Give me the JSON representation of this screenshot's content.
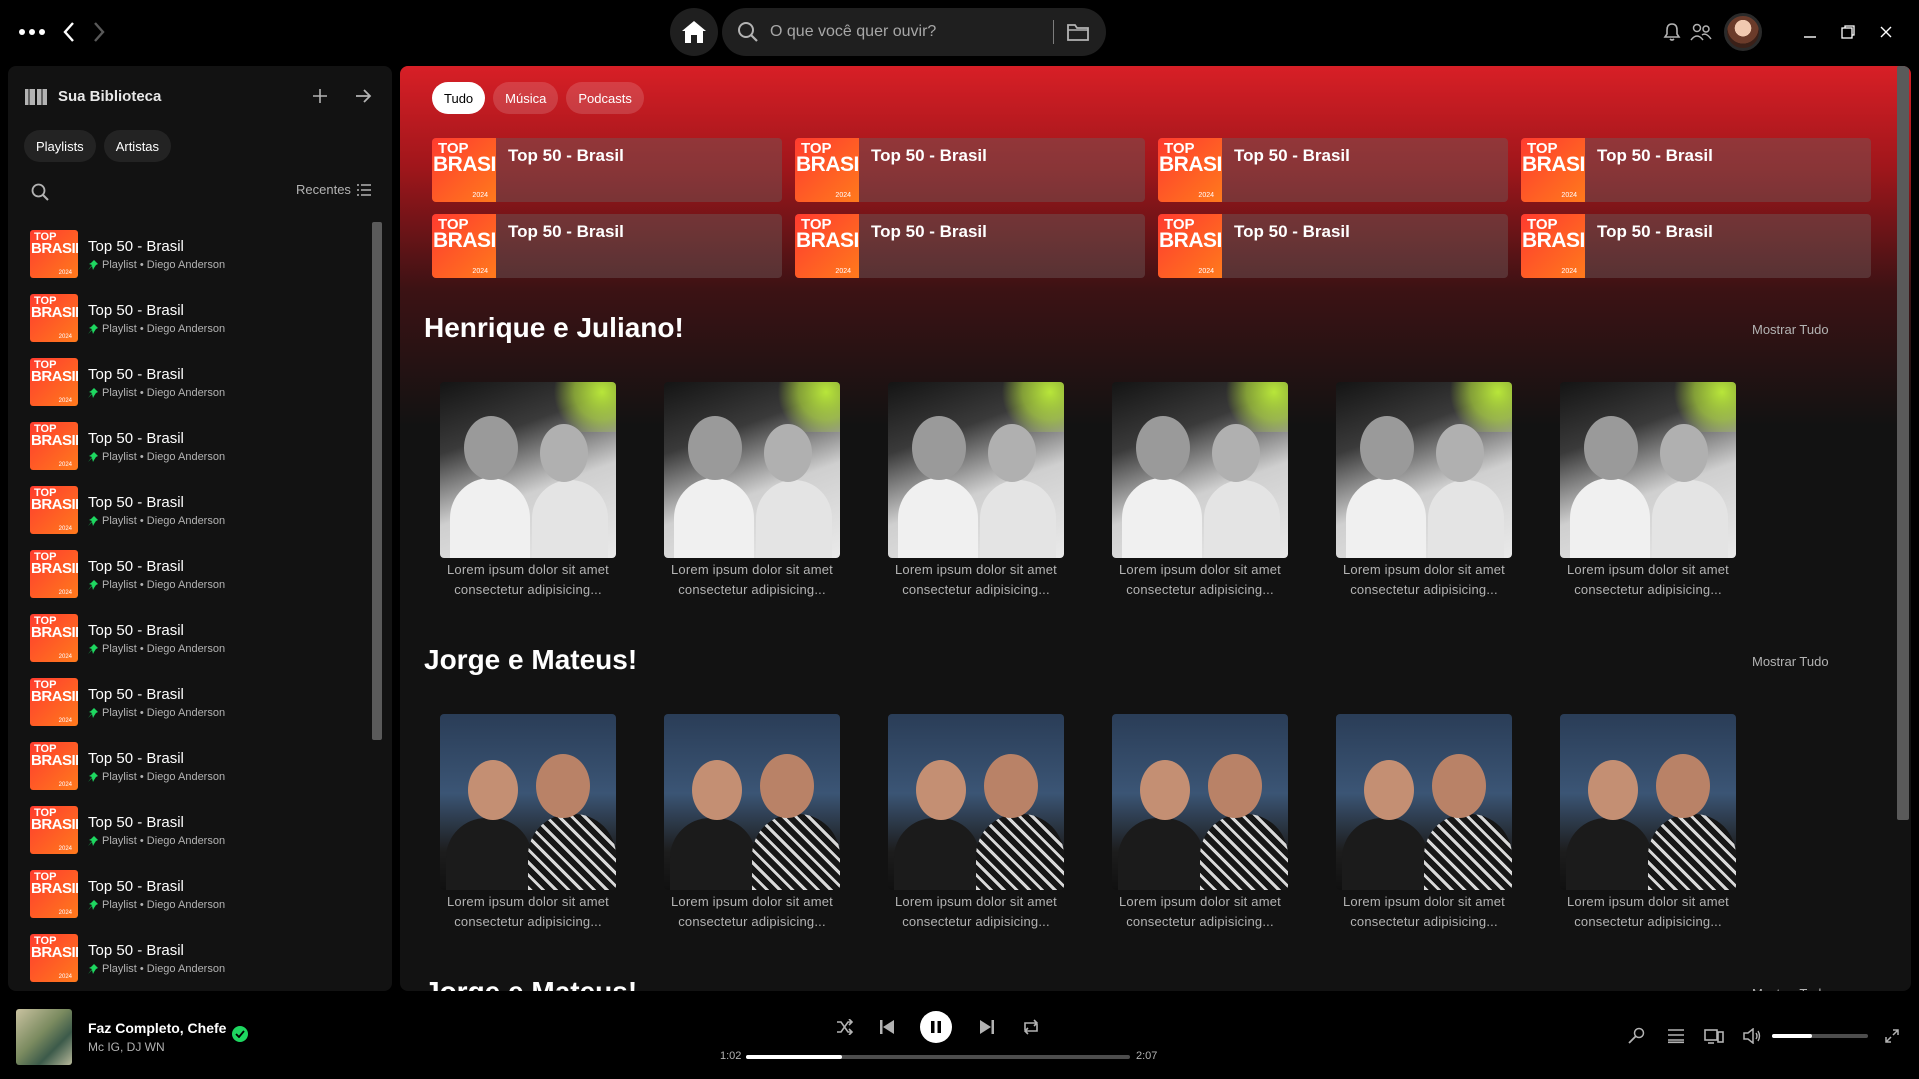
{
  "search": {
    "placeholder": "O que você quer ouvir?"
  },
  "sidebar": {
    "title": "Sua Biblioteca",
    "chips": [
      "Playlists",
      "Artistas"
    ],
    "sort_label": "Recentes",
    "items": [
      {
        "title": "Top 50 - Brasil",
        "subtitle": "Playlist • Diego Anderson"
      },
      {
        "title": "Top 50 - Brasil",
        "subtitle": "Playlist • Diego Anderson"
      },
      {
        "title": "Top 50 - Brasil",
        "subtitle": "Playlist • Diego Anderson"
      },
      {
        "title": "Top 50 - Brasil",
        "subtitle": "Playlist • Diego Anderson"
      },
      {
        "title": "Top 50 - Brasil",
        "subtitle": "Playlist • Diego Anderson"
      },
      {
        "title": "Top 50 - Brasil",
        "subtitle": "Playlist • Diego Anderson"
      },
      {
        "title": "Top 50 - Brasil",
        "subtitle": "Playlist • Diego Anderson"
      },
      {
        "title": "Top 50 - Brasil",
        "subtitle": "Playlist • Diego Anderson"
      },
      {
        "title": "Top 50 - Brasil",
        "subtitle": "Playlist • Diego Anderson"
      },
      {
        "title": "Top 50 - Brasil",
        "subtitle": "Playlist • Diego Anderson"
      },
      {
        "title": "Top 50 - Brasil",
        "subtitle": "Playlist • Diego Anderson"
      },
      {
        "title": "Top 50 - Brasil",
        "subtitle": "Playlist • Diego Anderson"
      }
    ]
  },
  "cover": {
    "line1": "TOP",
    "line2": "BRASIL",
    "year": "2024"
  },
  "main": {
    "filters": [
      "Tudo",
      "Música",
      "Podcasts"
    ],
    "quick_access": [
      "Top 50 - Brasil",
      "Top 50 - Brasil",
      "Top 50 - Brasil",
      "Top 50 - Brasil",
      "Top 50 - Brasil",
      "Top 50 - Brasil",
      "Top 50 - Brasil",
      "Top 50 - Brasil"
    ],
    "sections": [
      {
        "title": "Henrique e Juliano!",
        "show_all": "Mostrar Tudo",
        "cards": [
          {
            "line1": "Lorem ipsum dolor sit amet",
            "line2": "consectetur adipisicing..."
          },
          {
            "line1": "Lorem ipsum dolor sit amet",
            "line2": "consectetur adipisicing..."
          },
          {
            "line1": "Lorem ipsum dolor sit amet",
            "line2": "consectetur adipisicing..."
          },
          {
            "line1": "Lorem ipsum dolor sit amet",
            "line2": "consectetur adipisicing..."
          },
          {
            "line1": "Lorem ipsum dolor sit amet",
            "line2": "consectetur adipisicing..."
          },
          {
            "line1": "Lorem ipsum dolor sit amet",
            "line2": "consectetur adipisicing..."
          }
        ]
      },
      {
        "title": "Jorge e Mateus!",
        "show_all": "Mostrar Tudo",
        "cards": [
          {
            "line1": "Lorem ipsum dolor sit amet",
            "line2": "consectetur adipisicing..."
          },
          {
            "line1": "Lorem ipsum dolor sit amet",
            "line2": "consectetur adipisicing..."
          },
          {
            "line1": "Lorem ipsum dolor sit amet",
            "line2": "consectetur adipisicing..."
          },
          {
            "line1": "Lorem ipsum dolor sit amet",
            "line2": "consectetur adipisicing..."
          },
          {
            "line1": "Lorem ipsum dolor sit amet",
            "line2": "consectetur adipisicing..."
          },
          {
            "line1": "Lorem ipsum dolor sit amet",
            "line2": "consectetur adipisicing..."
          }
        ]
      }
    ]
  },
  "player": {
    "track": "Faz Completo, Chefe",
    "artists": "Mc IG, DJ WN",
    "elapsed": "1:02",
    "duration": "2:07",
    "progress_fraction": 0.25,
    "volume_fraction": 0.42
  },
  "colors": {
    "accent": "#1ed760",
    "header_red": "#d81f26",
    "background": "#121212"
  },
  "icons": [
    "menu-dots-icon",
    "back-icon",
    "forward-icon",
    "home-icon",
    "search-icon",
    "browse-icon",
    "bell-icon",
    "friends-icon",
    "minimize-icon",
    "maximize-icon",
    "close-icon",
    "library-icon",
    "plus-icon",
    "arrow-right-icon",
    "list-icon",
    "pin-icon",
    "shuffle-icon",
    "previous-icon",
    "pause-icon",
    "next-icon",
    "repeat-icon",
    "lyrics-icon",
    "queue-icon",
    "device-icon",
    "volume-icon",
    "fullscreen-icon",
    "check-icon"
  ]
}
